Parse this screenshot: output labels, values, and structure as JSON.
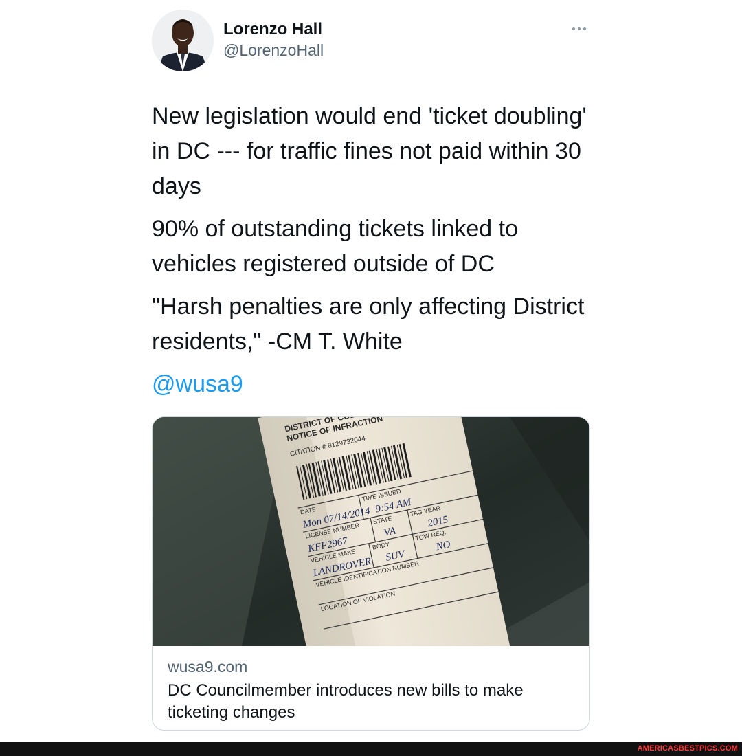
{
  "author": {
    "display_name": "Lorenzo Hall",
    "handle": "@LorenzoHall"
  },
  "tweet": {
    "paragraphs": [
      "New legislation would end 'ticket doubling' in DC --- for traffic fines not paid within 30 days",
      "90% of outstanding tickets linked to vehicles registered outside of DC",
      "\"Harsh penalties are only affecting District residents,\" -CM T. White"
    ],
    "mention": "@wusa9"
  },
  "card": {
    "domain": "wusa9.com",
    "title": "DC Councilmember introduces new bills to make ticketing changes",
    "image": {
      "header_line1": "DISTRICT OF COLUMBIA",
      "header_line2": "NOTICE OF INFRACTION",
      "citation": "CITATION # 8129732044",
      "time_issued_label": "TIME ISSUED",
      "date_label": "DATE",
      "date_value": "Mon 07/14/2014",
      "time_value": "9:54 AM",
      "license_label": "LICENSE NUMBER",
      "state_label": "STATE",
      "tag_year_label": "TAG YEAR",
      "license_value": "KFF2967",
      "state_value": "VA",
      "tag_year_value": "2015",
      "make_label": "VEHICLE MAKE",
      "body_label": "BODY",
      "tow_label": "TOW REQ.",
      "make_value": "LANDROVER",
      "body_value": "SUV",
      "tow_value": "NO",
      "vin_label": "VEHICLE IDENTIFICATION NUMBER",
      "location_label": "LOCATION OF VIOLATION"
    }
  },
  "watermark": "AMERICASBESTPICS.COM",
  "colors": {
    "link": "#1d9bf0",
    "secondary_text": "#536471",
    "watermark": "#ff3b3b"
  },
  "icons": {
    "more": "more-options-icon"
  }
}
